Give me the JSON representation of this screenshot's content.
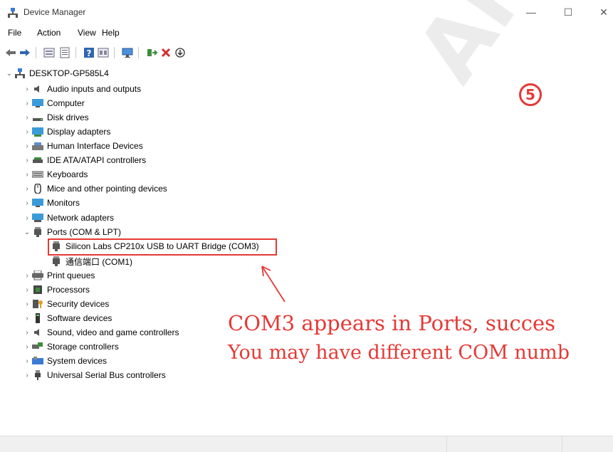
{
  "window": {
    "title": "Device Manager",
    "minimize": "—",
    "maximize": "☐",
    "close": "✕"
  },
  "menu": [
    "File",
    "Action",
    "View",
    "Help"
  ],
  "tree": {
    "root": "DESKTOP-GP585L4",
    "items": [
      "Audio inputs and outputs",
      "Computer",
      "Disk drives",
      "Display adapters",
      "Human Interface Devices",
      "IDE ATA/ATAPI controllers",
      "Keyboards",
      "Mice and other pointing devices",
      "Monitors",
      "Network adapters",
      "Ports (COM & LPT)",
      "Silicon Labs CP210x USB to UART Bridge (COM3)",
      "通信端口 (COM1)",
      "Print queues",
      "Processors",
      "Security devices",
      "Software devices",
      "Sound, video and game controllers",
      "Storage controllers",
      "System devices",
      "Universal Serial Bus controllers"
    ]
  },
  "annotations": {
    "step": "5",
    "line1": "COM3 appears in Ports, succes",
    "line2": "You may have different COM numb",
    "watermark": "ANYC",
    "accent": "#e53935"
  }
}
